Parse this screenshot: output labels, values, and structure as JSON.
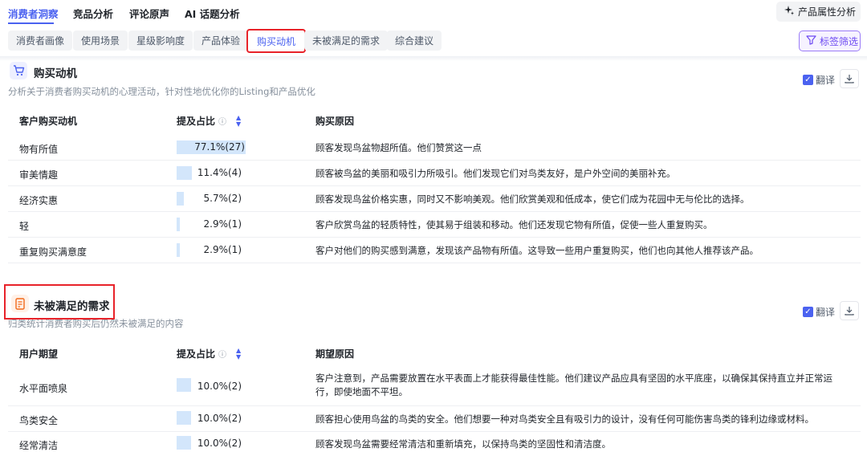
{
  "topnav": {
    "tabs": [
      {
        "label": "消费者洞察",
        "active": true
      },
      {
        "label": "竞品分析",
        "active": false
      },
      {
        "label": "评论原声",
        "active": false
      },
      {
        "label": "AI 话题分析",
        "active": false
      }
    ],
    "attr_button": "产品属性分析"
  },
  "subtabs": [
    {
      "label": "消费者画像",
      "active": false
    },
    {
      "label": "使用场景",
      "active": false
    },
    {
      "label": "星级影响度",
      "active": false
    },
    {
      "label": "产品体验",
      "active": false
    },
    {
      "label": "购买动机",
      "active": true
    },
    {
      "label": "未被满足的需求",
      "active": false
    },
    {
      "label": "综合建议",
      "active": false
    }
  ],
  "filter_button": "标签筛选",
  "motivation": {
    "title": "购买动机",
    "desc": "分析关于消费者购买动机的心理活动，针对性地优化你的Listing和产品优化",
    "translate": "翻译",
    "col1": "客户购买动机",
    "col2": "提及占比",
    "col3": "购买原因",
    "rows": [
      {
        "name": "物有所值",
        "share": 0.771,
        "pct": "77.1%(27)",
        "reason": "顾客发现鸟盆物超所值。他们赞赏这一点"
      },
      {
        "name": "审美情趣",
        "share": 0.114,
        "pct": "11.4%(4)",
        "reason": "顾客被鸟盆的美丽和吸引力所吸引。他们发现它们对鸟类友好，是户外空间的美丽补充。"
      },
      {
        "name": "经济实惠",
        "share": 0.057,
        "pct": "5.7%(2)",
        "reason": "顾客发现鸟盆价格实惠，同时又不影响美观。他们欣赏美观和低成本，使它们成为花园中无与伦比的选择。"
      },
      {
        "name": "轻",
        "share": 0.029,
        "pct": "2.9%(1)",
        "reason": "客户欣赏鸟盆的轻质特性，使其易于组装和移动。他们还发现它物有所值，促使一些人重复购买。"
      },
      {
        "name": "重复购买满意度",
        "share": 0.029,
        "pct": "2.9%(1)",
        "reason": "客户对他们的购买感到满意，发现该产品物有所值。这导致一些用户重复购买，他们也向其他人推荐该产品。"
      }
    ]
  },
  "unmet": {
    "title": "未被满足的需求",
    "desc": "归类统计消费者购买后仍然未被满足的内容",
    "translate": "翻译",
    "col1": "用户期望",
    "col2": "提及占比",
    "col3": "期望原因",
    "rows": [
      {
        "name": "水平面喷泉",
        "share": 0.1,
        "pct": "10.0%(2)",
        "reason": "客户注意到，产品需要放置在水平表面上才能获得最佳性能。他们建议产品应具有坚固的水平底座，以确保其保持直立并正常运行，即使地面不平坦。"
      },
      {
        "name": "鸟类安全",
        "share": 0.1,
        "pct": "10.0%(2)",
        "reason": "顾客担心使用鸟盆的鸟类的安全。他们想要一种对鸟类安全且有吸引力的设计，没有任何可能伤害鸟类的锋利边缘或材料。"
      },
      {
        "name": "经常清洁",
        "share": 0.1,
        "pct": "10.0%(2)",
        "reason": "顾客发现鸟盆需要经常清洁和重新填充，以保持鸟类的坚固性和清洁度。"
      }
    ]
  },
  "colors": {
    "accent": "#4b62f0",
    "bar": "#d3e6fb",
    "highlight": "#e8232a"
  }
}
